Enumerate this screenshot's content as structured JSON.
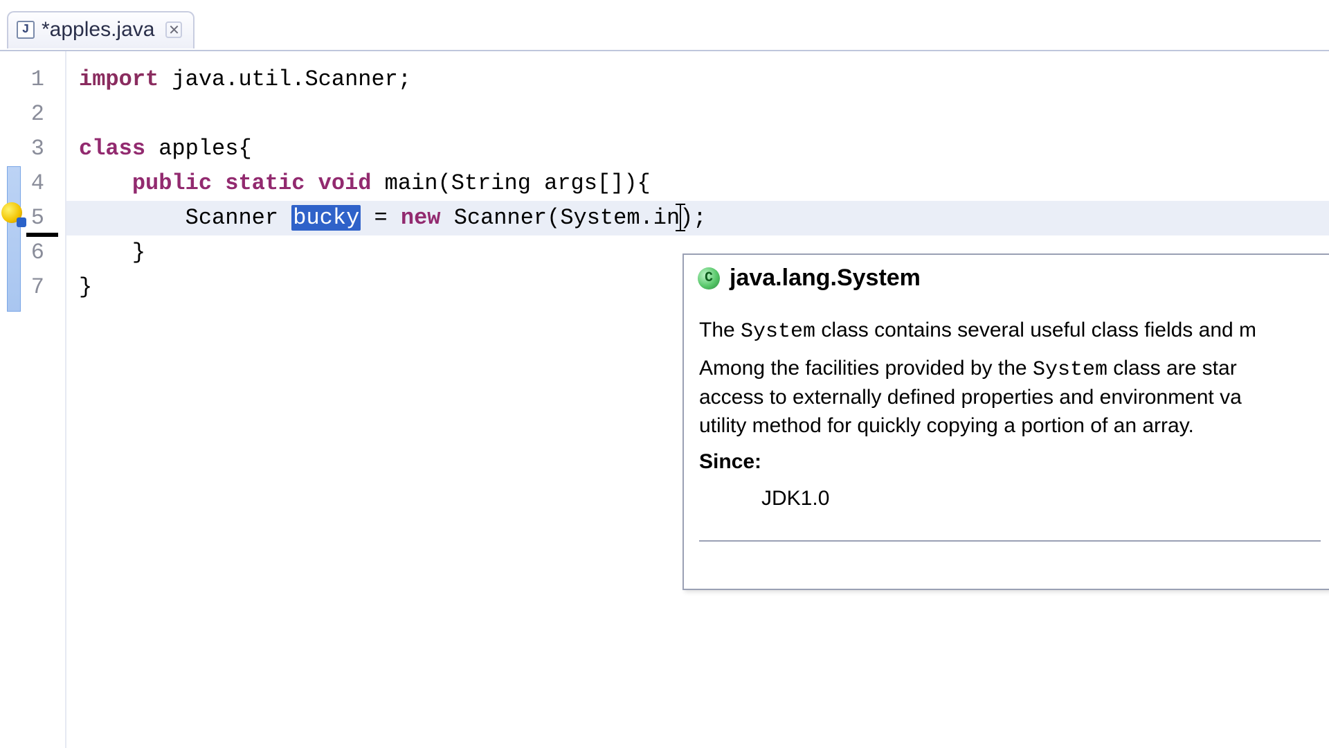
{
  "tab": {
    "file_icon_letter": "J",
    "title": "*apples.java",
    "close_glyph": "✕"
  },
  "lines": {
    "l1": "1",
    "l2": "2",
    "l3": "3",
    "l4": "4",
    "l5": "5",
    "l6": "6",
    "l7": "7"
  },
  "fold_glyph": "−",
  "code": {
    "kw_import": "import",
    "import_rest": " java.util.Scanner;",
    "kw_class": "class",
    "class_rest": " apples{",
    "kw_public": "public",
    "kw_static": "static",
    "kw_void": "void",
    "main_sig": " main(String args[]){",
    "line5_pre": "        Scanner ",
    "line5_sel": "bucky",
    "line5_mid": " = ",
    "kw_new": "new",
    "line5_post": " Scanner(System.in);",
    "line6": "    }",
    "line7": "}"
  },
  "tooltip": {
    "icon_letter": "C",
    "title": "java.lang.System",
    "p1_a": "The ",
    "p1_sys": "System",
    "p1_b": " class contains several useful class fields and m",
    "p2_a": "Among the facilities provided by the ",
    "p2_sys": "System",
    "p2_b": " class are star",
    "p2_c": "access to externally defined properties and environment va",
    "p2_d": "utility method for quickly copying a portion of an array.",
    "since_label": "Since:",
    "since_value": "JDK1.0"
  }
}
